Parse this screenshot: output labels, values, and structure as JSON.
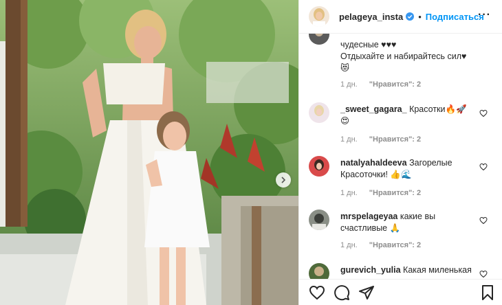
{
  "post": {
    "username": "pelageya_insta",
    "separator": "•",
    "follow_label": "Подписаться",
    "more_label": "···"
  },
  "comments": [
    {
      "user": "",
      "lines": [
        "чудесные ♥♥♥",
        "Отдыхайте и набирайтесь сил♥",
        "😻"
      ],
      "time": "1 дн.",
      "likes": "\"Нравится\": 2"
    },
    {
      "user": "_sweet_gagara_",
      "lines": [
        "Красотки🔥🚀",
        "😍"
      ],
      "time": "1 дн.",
      "likes": "\"Нравится\": 2"
    },
    {
      "user": "natalyahaldeeva",
      "lines": [
        "Загорелые",
        "Красоточки! 👍🌊"
      ],
      "time": "1 дн.",
      "likes": "\"Нравится\": 2"
    },
    {
      "user": "mrspelageyaa",
      "lines": [
        "какие вы",
        "счастливые 🙏"
      ],
      "time": "1 дн.",
      "likes": "\"Нравится\": 2"
    },
    {
      "user": "gurevich_yulia",
      "lines": [
        "Какая миленькая"
      ],
      "time": "",
      "likes": ""
    }
  ],
  "colors": {
    "accent": "#0095f6",
    "verified": "#3897f0",
    "muted": "#8e8e8e",
    "text": "#262626"
  },
  "icons": [
    "verified-badge-icon",
    "more-icon",
    "heart-icon",
    "comment-icon",
    "share-icon",
    "bookmark-icon",
    "chevron-right-icon"
  ]
}
